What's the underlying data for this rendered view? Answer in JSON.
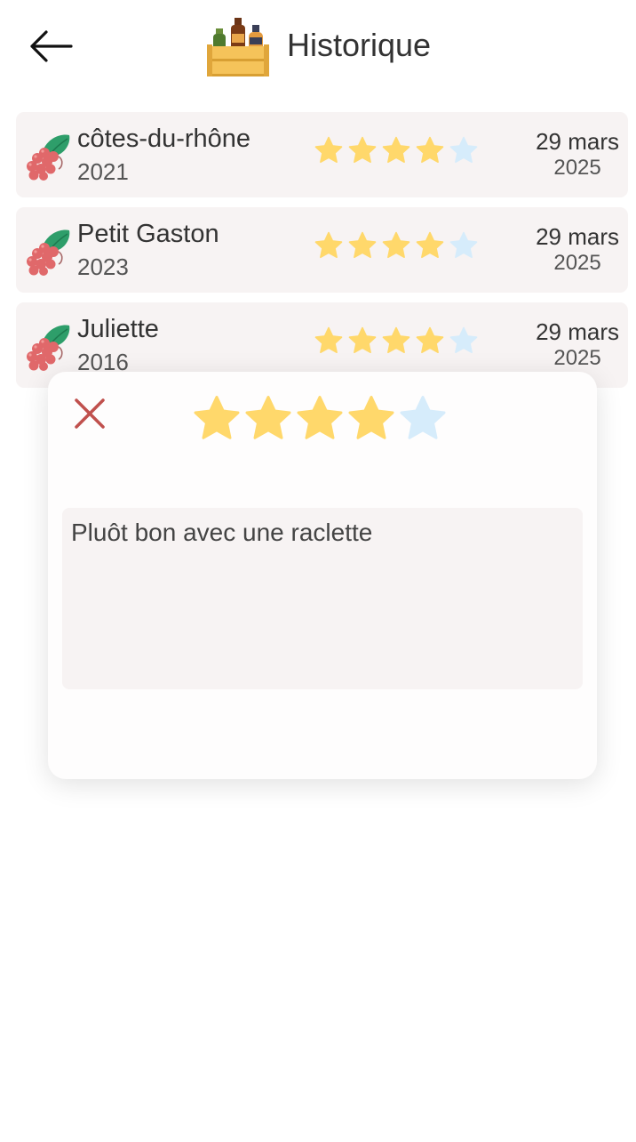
{
  "header": {
    "title": "Historique",
    "back_icon": "arrow-left-icon",
    "logo_icon": "wine-crate-icon"
  },
  "colors": {
    "star_filled": "#ffd86b",
    "star_empty": "#d6ecfb",
    "row_bg": "#f7f3f3",
    "close": "#c0504d"
  },
  "history": [
    {
      "name": "côtes-du-rhône",
      "year": "2021",
      "rating": 4,
      "max_rating": 5,
      "date_day_month": "29 mars",
      "date_year": "2025",
      "icon": "grapes-icon"
    },
    {
      "name": "Petit Gaston",
      "year": "2023",
      "rating": 4,
      "max_rating": 5,
      "date_day_month": "29 mars",
      "date_year": "2025",
      "icon": "grapes-icon"
    },
    {
      "name": "Juliette",
      "year": "2016",
      "rating": 4,
      "max_rating": 5,
      "date_day_month": "29 mars",
      "date_year": "2025",
      "icon": "grapes-icon"
    }
  ],
  "modal": {
    "close_icon": "close-icon",
    "rating": 4,
    "max_rating": 5,
    "comment": "Pluôt bon avec une raclette"
  }
}
